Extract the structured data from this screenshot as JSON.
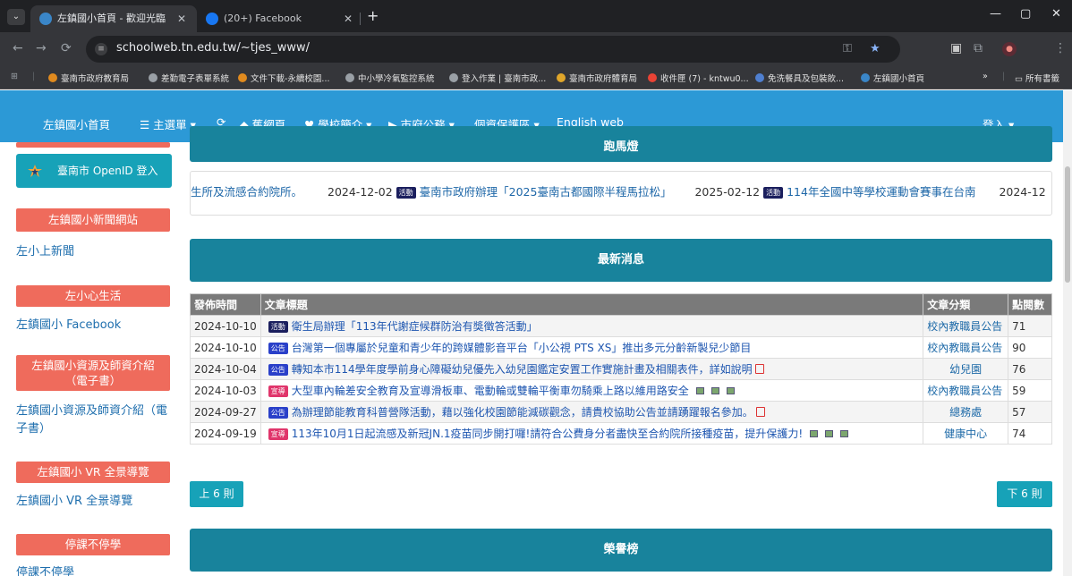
{
  "browser": {
    "tabs": [
      {
        "title": "左鎮國小首頁 - 歡迎光臨",
        "active": true
      },
      {
        "title": "(20+) Facebook",
        "active": false
      }
    ],
    "url": "schoolweb.tn.edu.tw/~tjes_www/",
    "bookmarks": [
      "臺南市政府教育局",
      "差勤電子表單系統",
      "文件下載-永續校園...",
      "中小學冷氣監控系統",
      "登入作業 | 臺南市政...",
      "臺南市政府體育局",
      "收件匣 (7) - kntwu0...",
      "免洗餐具及包裝飲...",
      "左鎮國小首頁"
    ],
    "bookmarks_more": "»",
    "all_bookmarks": "所有書籤"
  },
  "site_nav": {
    "home": "左鎮國小首頁",
    "main_menu": "☰ 主選單 ▾",
    "refresh": "⟳",
    "old_site": "舊網頁",
    "intro": "學校簡介 ▾",
    "city": "市府公務 ▾",
    "privacy": "個資保護區 ▾",
    "english": "English web",
    "login": "登入 ▾"
  },
  "sidebar": {
    "openid": "臺南市 OpenID 登入",
    "sections": [
      {
        "header": "左鎮國小新聞網站",
        "link": "左小上新聞"
      },
      {
        "header": "左小心生活",
        "link": "左鎮國小 Facebook"
      },
      {
        "header": "左鎮國小資源及師資介紹（電子書）",
        "link": "左鎮國小資源及師資介紹（電子書）"
      },
      {
        "header": "左鎮國小 VR 全景導覽",
        "link": "左鎮國小 VR 全景導覽"
      },
      {
        "header": "停課不停學",
        "link": "停課不停學"
      }
    ]
  },
  "marquee": {
    "header": "跑馬燈",
    "lead": "生所及流感合約院所。",
    "items": [
      {
        "date": "2024-12-02",
        "tag": "活動",
        "text": "臺南市政府辦理「2025臺南古都國際半程馬拉松」"
      },
      {
        "date": "2025-02-12",
        "tag": "活動",
        "text": "114年全國中等學校運動會賽事在台南"
      },
      {
        "date": "2024-12",
        "tag": "",
        "text": ""
      }
    ]
  },
  "news": {
    "header": "最新消息",
    "columns": [
      "發佈時間",
      "文章標題",
      "文章分類",
      "點閱數"
    ],
    "rows": [
      {
        "date": "2024-10-10",
        "tag": "活動",
        "title": "衛生局辦理「113年代謝症候群防治有獎徵答活動」",
        "icons": "",
        "category": "校內教職員公告",
        "views": "71"
      },
      {
        "date": "2024-10-10",
        "tag": "公告",
        "title": "台灣第一個專屬於兒童和青少年的跨媒體影音平台「小公視 PTS XS」推出多元分齡新製兒少節目",
        "icons": "",
        "category": "校內教職員公告",
        "views": "90"
      },
      {
        "date": "2024-10-04",
        "tag": "公告",
        "title": "轉知本市114學年度學前身心障礙幼兒優先入幼兒園鑑定安置工作實施計畫及相關表件，詳如說明",
        "icons": "pdf",
        "category": "幼兒園",
        "views": "76"
      },
      {
        "date": "2024-10-03",
        "tag": "宣導",
        "title": "大型車內輪差安全教育及宣導滑板車、電動輪或雙輪平衡車勿騎乘上路以維用路安全",
        "icons": "img3",
        "category": "校內教職員公告",
        "views": "59"
      },
      {
        "date": "2024-09-27",
        "tag": "公告",
        "title": "為辦理節能教育科普營隊活動，藉以強化校園節能減碳觀念，請貴校協助公告並請踴躍報名參加。",
        "icons": "pdf",
        "category": "總務處",
        "views": "57"
      },
      {
        "date": "2024-09-19",
        "tag": "宣導",
        "title": "113年10月1日起流感及新冠JN.1疫苗同步開打囉!請符合公費身分者盡快至合約院所接種疫苗，提升保護力!",
        "icons": "img3",
        "category": "健康中心",
        "views": "74"
      }
    ],
    "prev": "上 6 則",
    "next": "下 6 則"
  },
  "honor": {
    "header": "榮譽榜"
  },
  "colors": {
    "nav": "#2c99d6",
    "teal": "#18839c",
    "side": "#ef6b5c"
  }
}
